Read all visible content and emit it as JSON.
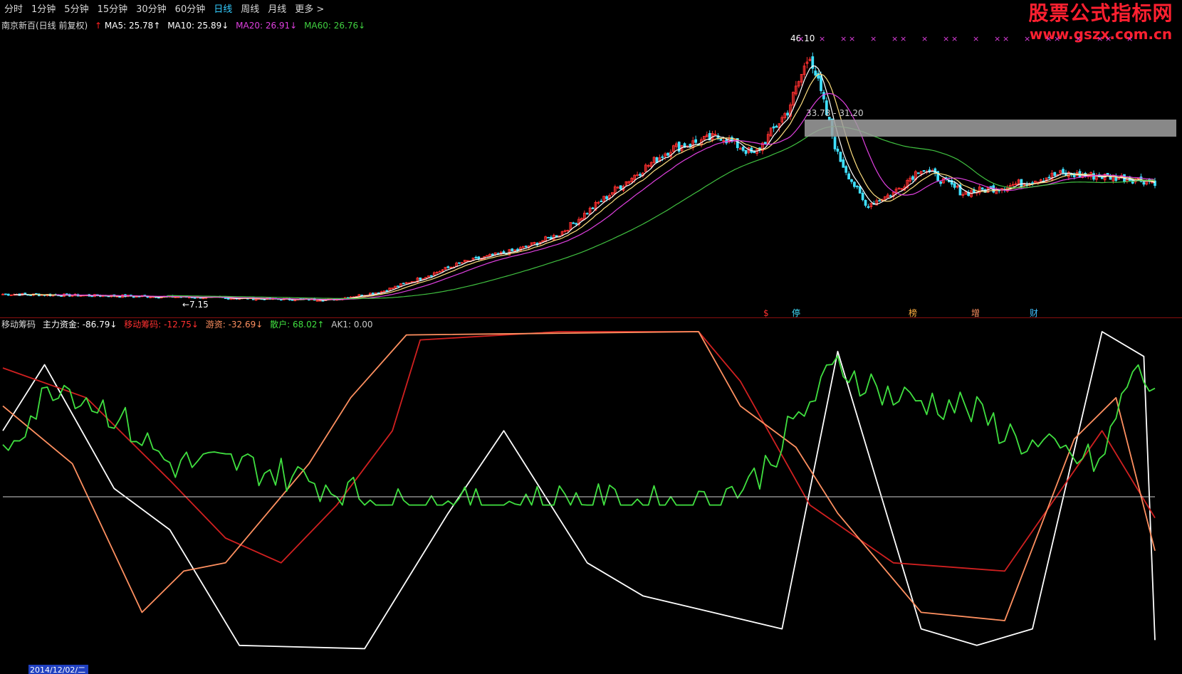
{
  "tabs": [
    {
      "label": "分时",
      "active": false
    },
    {
      "label": "1分钟",
      "active": false
    },
    {
      "label": "5分钟",
      "active": false
    },
    {
      "label": "15分钟",
      "active": false
    },
    {
      "label": "30分钟",
      "active": false
    },
    {
      "label": "60分钟",
      "active": false
    },
    {
      "label": "日线",
      "active": true
    },
    {
      "label": "周线",
      "active": false
    },
    {
      "label": "月线",
      "active": false
    },
    {
      "label": "更多 >",
      "active": false
    }
  ],
  "watermark": {
    "line1": "股票公式指标网",
    "line2": "www.gszx.com.cn"
  },
  "main_legend": {
    "title": "南京新百(日线 前复权)",
    "items": [
      {
        "text": "MA5: 25.78↑",
        "color": "#ffffff"
      },
      {
        "text": "MA10: 25.89↓",
        "color": "#ffffff"
      },
      {
        "text": "MA20: 26.91↓",
        "color": "#e040e0"
      },
      {
        "text": "MA60: 26.76↓",
        "color": "#40d040"
      }
    ]
  },
  "sub_legend": {
    "title": "移动筹码",
    "items": [
      {
        "text": "主力资金: -86.79↓",
        "color": "#ffffff"
      },
      {
        "text": "移动筹码: -12.75↓",
        "color": "#ff3030"
      },
      {
        "text": "游资: -32.69↓",
        "color": "#ff9060"
      },
      {
        "text": "散户: 68.02↑",
        "color": "#40e040"
      },
      {
        "text": "AK1: 0.00",
        "color": "#c8c8c8"
      }
    ]
  },
  "colors": {
    "up": "#ff3030",
    "down": "#40e0ff",
    "ma5": "#ffffff",
    "ma10": "#ffe080",
    "ma20": "#e040e0",
    "ma60": "#40c040",
    "white": "#ffffff",
    "orange": "#ff9060",
    "red": "#d02020",
    "green": "#40e040"
  },
  "annotations": {
    "high": "46.10",
    "low": "7.15",
    "box": "33.78 - 31.20"
  },
  "markers": [
    "$",
    "停",
    "榜",
    "增",
    "财"
  ],
  "date_label": "2014/12/02/二",
  "chart_data": [
    {
      "type": "candlestick",
      "series": [
        {
          "name": "MA5"
        },
        {
          "name": "MA10"
        },
        {
          "name": "MA20"
        },
        {
          "name": "MA60"
        }
      ],
      "price_anchor_points": [
        {
          "x": 0,
          "y": 8.0
        },
        {
          "x": 60,
          "y": 7.6
        },
        {
          "x": 100,
          "y": 7.2
        },
        {
          "x": 118,
          "y": 7.15
        },
        {
          "x": 128,
          "y": 7.8
        },
        {
          "x": 136,
          "y": 8.4
        },
        {
          "x": 150,
          "y": 10.5
        },
        {
          "x": 165,
          "y": 13.0
        },
        {
          "x": 185,
          "y": 15.0
        },
        {
          "x": 200,
          "y": 17.5
        },
        {
          "x": 220,
          "y": 24.5
        },
        {
          "x": 240,
          "y": 31.0
        },
        {
          "x": 258,
          "y": 33.0
        },
        {
          "x": 270,
          "y": 30.0
        },
        {
          "x": 282,
          "y": 37.0
        },
        {
          "x": 290,
          "y": 46.1
        },
        {
          "x": 300,
          "y": 30.0
        },
        {
          "x": 310,
          "y": 22.0
        },
        {
          "x": 320,
          "y": 24.0
        },
        {
          "x": 330,
          "y": 28.0
        },
        {
          "x": 345,
          "y": 24.0
        },
        {
          "x": 360,
          "y": 25.0
        },
        {
          "x": 380,
          "y": 27.0
        },
        {
          "x": 400,
          "y": 26.5
        },
        {
          "x": 414,
          "y": 25.8
        }
      ],
      "ylim": [
        5,
        50
      ]
    },
    {
      "type": "line",
      "series": [
        {
          "name": "主力资金",
          "points": [
            [
              0,
              40
            ],
            [
              15,
              80
            ],
            [
              40,
              5
            ],
            [
              60,
              -20
            ],
            [
              85,
              -90
            ],
            [
              130,
              -92
            ],
            [
              160,
              -10
            ],
            [
              180,
              40
            ],
            [
              210,
              -40
            ],
            [
              230,
              -60
            ],
            [
              255,
              -70
            ],
            [
              280,
              -80
            ],
            [
              300,
              88
            ],
            [
              330,
              -80
            ],
            [
              350,
              -90
            ],
            [
              370,
              -80
            ],
            [
              395,
              100
            ],
            [
              410,
              85
            ],
            [
              414,
              -86.79
            ]
          ]
        },
        {
          "name": "移动筹码",
          "points": [
            [
              0,
              78
            ],
            [
              30,
              60
            ],
            [
              60,
              10
            ],
            [
              80,
              -25
            ],
            [
              100,
              -40
            ],
            [
              120,
              -5
            ],
            [
              140,
              40
            ],
            [
              150,
              95
            ],
            [
              200,
              100
            ],
            [
              250,
              100
            ],
            [
              265,
              70
            ],
            [
              290,
              -5
            ],
            [
              320,
              -40
            ],
            [
              360,
              -45
            ],
            [
              395,
              40
            ],
            [
              414,
              -12.75
            ]
          ]
        },
        {
          "name": "游资",
          "points": [
            [
              0,
              55
            ],
            [
              25,
              20
            ],
            [
              50,
              -70
            ],
            [
              65,
              -45
            ],
            [
              80,
              -40
            ],
            [
              110,
              20
            ],
            [
              125,
              60
            ],
            [
              145,
              98
            ],
            [
              250,
              100
            ],
            [
              265,
              55
            ],
            [
              285,
              30
            ],
            [
              300,
              -10
            ],
            [
              330,
              -70
            ],
            [
              360,
              -75
            ],
            [
              385,
              35
            ],
            [
              400,
              60
            ],
            [
              414,
              -32.69
            ]
          ]
        },
        {
          "name": "散户",
          "points": [
            [
              0,
              30
            ],
            [
              20,
              70
            ],
            [
              40,
              50
            ],
            [
              60,
              20
            ],
            [
              85,
              20
            ],
            [
              110,
              10
            ],
            [
              140,
              -5
            ],
            [
              170,
              -5
            ],
            [
              200,
              -2
            ],
            [
              250,
              -5
            ],
            [
              270,
              10
            ],
            [
              285,
              45
            ],
            [
              300,
              80
            ],
            [
              320,
              60
            ],
            [
              345,
              55
            ],
            [
              370,
              30
            ],
            [
              395,
              20
            ],
            [
              405,
              75
            ],
            [
              414,
              68.02
            ]
          ]
        },
        {
          "name": "AK1",
          "points": [
            [
              0,
              0
            ],
            [
              414,
              0
            ]
          ]
        }
      ],
      "ylim": [
        -100,
        100
      ]
    }
  ]
}
